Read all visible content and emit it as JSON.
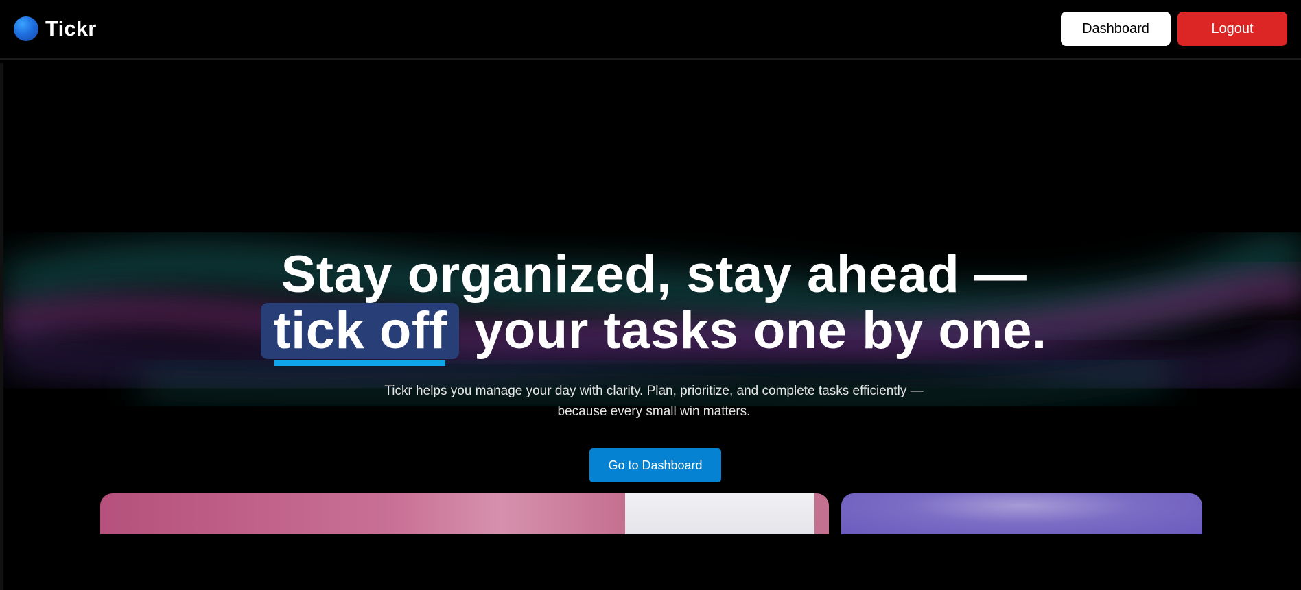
{
  "brand": {
    "name": "Tickr",
    "logo_icon": "logo-circle-icon"
  },
  "nav": {
    "dashboard_label": "Dashboard",
    "logout_label": "Logout"
  },
  "hero": {
    "headline_line1": "Stay organized, stay ahead —",
    "headline_highlight": "tick off",
    "headline_rest": " your tasks one by one.",
    "subtext_line1": "Tickr helps you manage your day with clarity. Plan, prioritize, and complete tasks efficiently —",
    "subtext_line2": "because every small win matters.",
    "cta_label": "Go to Dashboard"
  },
  "colors": {
    "background": "#000000",
    "logout": "#dc2626",
    "cta": "#0582d2",
    "highlight_bg": "#283e77",
    "highlight_underline": "#0ea5e9"
  }
}
